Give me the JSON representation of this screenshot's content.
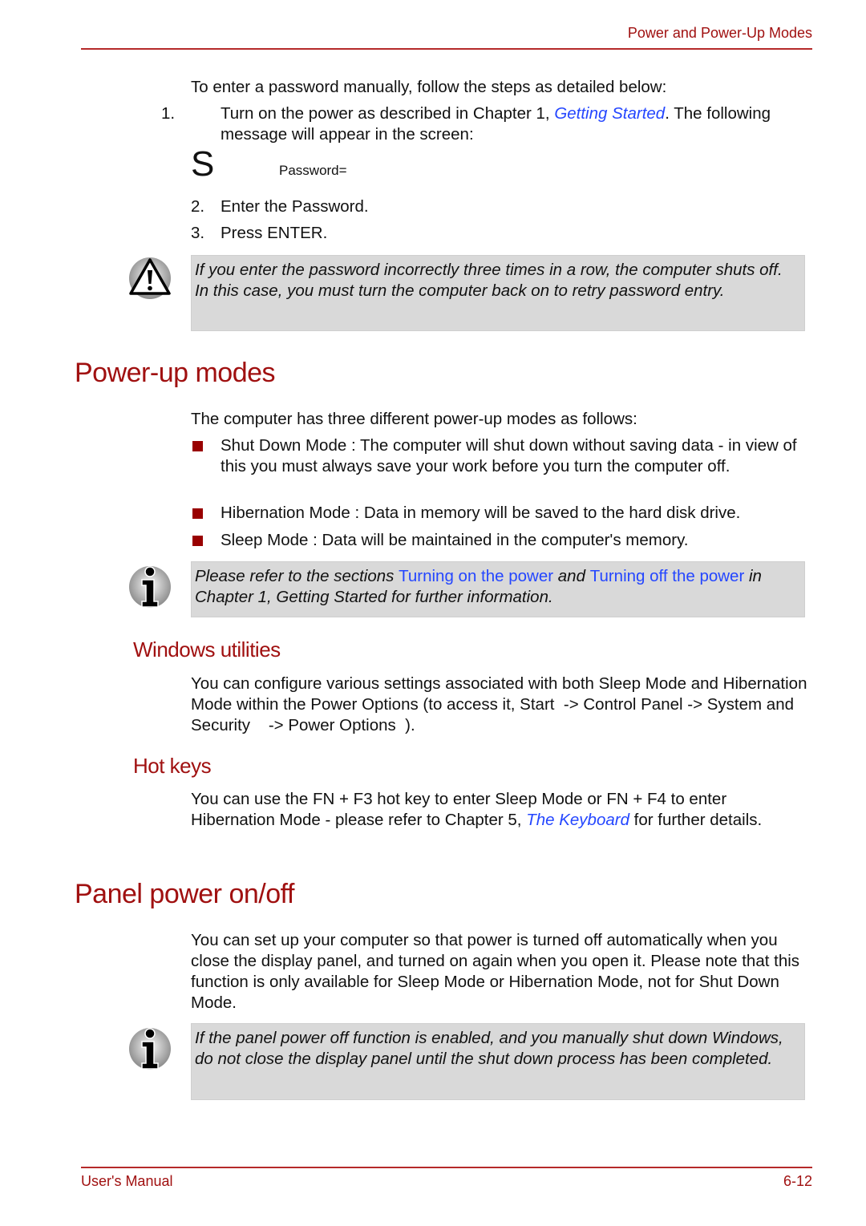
{
  "header": {
    "section_title": "Power and Power-Up Modes"
  },
  "intro": {
    "text": "To enter a password manually, follow the steps as detailed below:",
    "steps": [
      {
        "num": "1.",
        "before": "Turn on the power as described in Chapter 1, ",
        "link": "Getting Started",
        "after": ". The following message will appear in the screen:"
      },
      {
        "num": "2.",
        "text": "Enter the Password."
      },
      {
        "num": "3.",
        "text": "Press ENTER."
      }
    ],
    "screen_glyph": "S",
    "screen_message": "Password="
  },
  "warning_note": {
    "icon": "warning-icon",
    "text": "If you enter the password incorrectly three times in a row, the computer shuts off. In this case, you must turn the computer back on to retry password entry."
  },
  "power_up_modes": {
    "heading": "Power-up modes",
    "intro": "The computer has three different power-up modes as follows:",
    "bullets": [
      "Shut Down Mode : The computer will shut down without saving data - in view of this you must always save your work before you turn the computer off.",
      "Hibernation Mode : Data in memory will be saved to the hard disk drive.",
      "Sleep Mode : Data will be maintained in the computer's memory."
    ],
    "info_note": {
      "icon": "info-icon",
      "t1": "Please refer to the sections ",
      "link1": "Turning on the power",
      "t2": " and ",
      "link2": "Turning off the power",
      "t3": " in Chapter 1, Getting Started for further information."
    }
  },
  "windows_utilities": {
    "heading": "Windows utilities",
    "text": "You can configure various settings associated with both Sleep Mode and Hibernation Mode within the Power Options (to access it, Start  -> Control Panel -> System and Security    -> Power Options  )."
  },
  "hot_keys": {
    "heading": "Hot keys",
    "before": "You can use the FN + F3 hot key to enter Sleep Mode or FN + F4 to enter Hibernation Mode - please refer to Chapter 5, ",
    "link": "The Keyboard",
    "after": " for further details."
  },
  "panel_power": {
    "heading": "Panel power on/off",
    "text": "You can set up your computer so that power is turned off automatically when you close the display panel, and turned on again when you open it. Please note that this function is only available for Sleep Mode or Hibernation Mode, not for Shut Down Mode.",
    "info_note": {
      "icon": "info-icon",
      "text": "If the panel power off function is enabled, and you manually shut down Windows, do not close the display panel until the shut down process has been completed."
    }
  },
  "footer": {
    "left": "User's Manual",
    "right": "6-12"
  },
  "colors": {
    "accent": "#a01010",
    "link": "#2446ff",
    "note_bg": "#d9d9d9",
    "bullet": "#990000"
  }
}
